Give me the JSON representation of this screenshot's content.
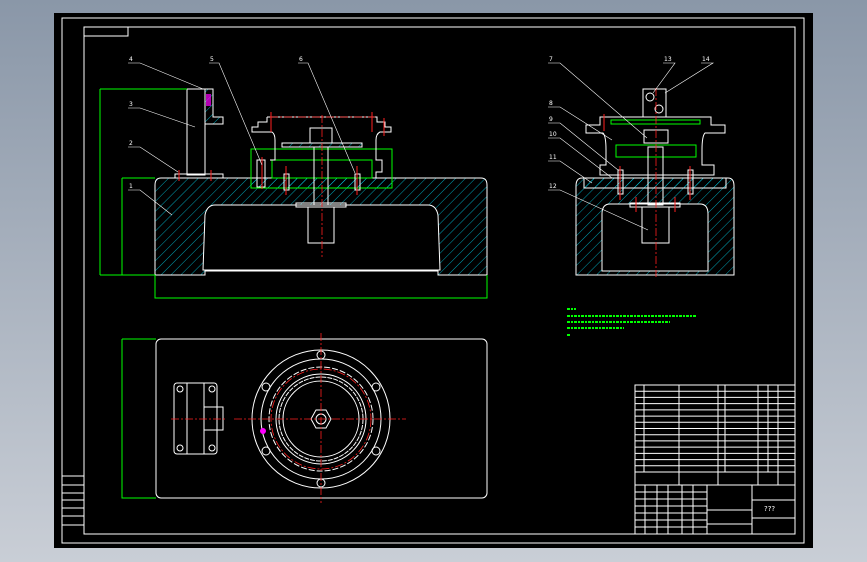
{
  "viewer": {
    "background_top": "#8a97a8",
    "background_bottom": "#c9ced6",
    "canvas_color": "#000000"
  },
  "colors": {
    "outline": "#ffffff",
    "dimension": "#00ff00",
    "centerline": "#ff2020",
    "hatch": "#00e5ff"
  },
  "front_view": {
    "part_labels": [
      "4",
      "5",
      "6",
      "3",
      "2",
      "1"
    ]
  },
  "side_view": {
    "part_labels": [
      "7",
      "13",
      "14",
      "8",
      "9",
      "10",
      "11",
      "12"
    ]
  },
  "title_block": {
    "drawing_name": "???"
  }
}
